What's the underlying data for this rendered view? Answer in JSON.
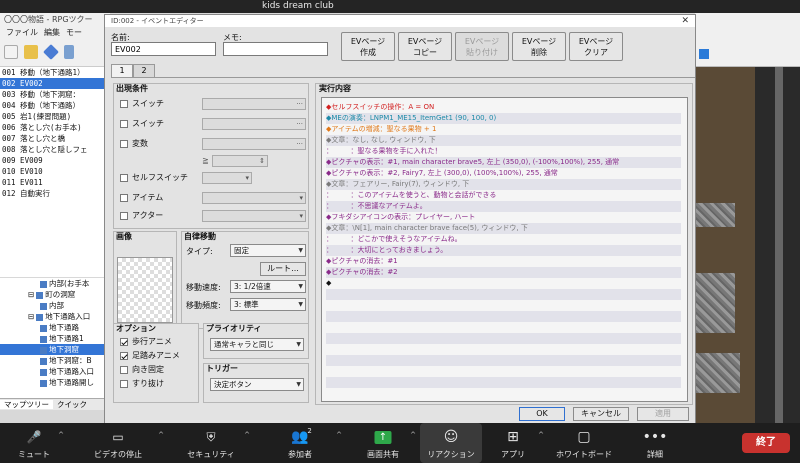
{
  "zoom": {
    "title": "kids dream club",
    "buttons": [
      {
        "icon": "microphone-icon",
        "label": "ミュート"
      },
      {
        "icon": "video-camera-icon",
        "label": "ビデオの停止"
      },
      {
        "icon": "security-shield-icon",
        "label": "セキュリティ"
      },
      {
        "icon": "participants-icon",
        "label": "参加者",
        "count": "2"
      },
      {
        "icon": "share-screen-icon",
        "label": "画面共有"
      },
      {
        "icon": "reaction-icon",
        "label": "リアクション"
      },
      {
        "icon": "apps-icon",
        "label": "アプリ"
      },
      {
        "icon": "whiteboard-icon",
        "label": "ホワイトボード"
      },
      {
        "icon": "more-dots-icon",
        "label": "詳細"
      }
    ],
    "end_label": "終了"
  },
  "app": {
    "title": "〇〇〇物語 - RPGツクー",
    "menu": [
      "ファイル",
      "編集",
      "モー"
    ],
    "map_events": [
      "001 移動（地下通路1）",
      "002 EV002",
      "003 移動（地下洞窟：",
      "004 移動（地下通路）",
      "005 岩1(練習問題)",
      "006 落とし穴(お手本)",
      "007 落とし穴と橋",
      "008 落とし穴と隠しフェ",
      "009 EV009",
      "010 EV010",
      "011 EV011",
      "012 自動実行"
    ],
    "selected_event_index": 1,
    "tree": [
      {
        "label": "内部(お手本",
        "indent": 3
      },
      {
        "label": "町の洞窟",
        "indent": 2,
        "toggle": "⊟"
      },
      {
        "label": "内部",
        "indent": 3
      },
      {
        "label": "地下通路入口",
        "indent": 2,
        "toggle": "⊟"
      },
      {
        "label": "地下通路",
        "indent": 3
      },
      {
        "label": "地下通路1",
        "indent": 3
      },
      {
        "label": "地下洞窟",
        "indent": 3,
        "selected": true
      },
      {
        "label": "地下洞窟：B",
        "indent": 3
      },
      {
        "label": "地下通路入口",
        "indent": 3
      },
      {
        "label": "地下通路開し",
        "indent": 3
      }
    ],
    "bottom_tabs": [
      "マップツリー",
      "クイック"
    ]
  },
  "dialog": {
    "title": "ID:002 - イベントエディター",
    "name_label": "名前:",
    "name_value": "EV002",
    "memo_label": "メモ:",
    "memo_value": "",
    "ev_buttons": [
      {
        "line1": "EVページ",
        "line2": "作成",
        "enabled": true
      },
      {
        "line1": "EVページ",
        "line2": "コピー",
        "enabled": true
      },
      {
        "line1": "EVページ",
        "line2": "貼り付け",
        "enabled": false
      },
      {
        "line1": "EVページ",
        "line2": "削除",
        "enabled": true
      },
      {
        "line1": "EVページ",
        "line2": "クリア",
        "enabled": true
      }
    ],
    "tabs": [
      "1",
      "2"
    ],
    "conditions": {
      "title": "出現条件",
      "switch1": "スイッチ",
      "switch2": "スイッチ",
      "variable": "変数",
      "ge": "≧",
      "self_switch": "セルフスイッチ",
      "item": "アイテム",
      "actor": "アクター"
    },
    "image_title": "画像",
    "autonomous": {
      "title": "自律移動",
      "type_label": "タイプ:",
      "type_value": "固定",
      "route_button": "ルート...",
      "speed_label": "移動速度:",
      "speed_value": "3: 1/2倍速",
      "freq_label": "移動頻度:",
      "freq_value": "3: 標準"
    },
    "options": {
      "title": "オプション",
      "walking": {
        "label": "歩行アニメ",
        "checked": true
      },
      "stepping": {
        "label": "足踏みアニメ",
        "checked": true
      },
      "direction_fix": {
        "label": "向き固定",
        "checked": false
      },
      "through": {
        "label": "すり抜け",
        "checked": false
      }
    },
    "priority": {
      "title": "プライオリティ",
      "value": "通常キャラと同じ"
    },
    "trigger": {
      "title": "トリガー",
      "value": "決定ボタン"
    },
    "contents_title": "実行内容",
    "commands": [
      {
        "text": "◆セルフスイッチの操作：A = ON",
        "color": "#d22020"
      },
      {
        "text": "◆MEの演奏：LNPM1_ME15_ItemGet1 (90, 100, 0)",
        "color": "#1c8aa8"
      },
      {
        "text": "◆アイテムの増減：聖なる果物 + 1",
        "color": "#e07818"
      },
      {
        "text": "◆文章：なし, なし, ウィンドウ, 下",
        "color": "#7a7a7a"
      },
      {
        "text": "：　　　：聖なる果物を手に入れた！",
        "color": "#8a2a8a"
      },
      {
        "text": "◆ピクチャの表示：#1, main character brave5, 左上 (350,0), (-100%,100%), 255, 通常",
        "color": "#8a2a8a"
      },
      {
        "text": "◆ピクチャの表示：#2, Fairy7, 左上 (300,0), (100%,100%), 255, 通常",
        "color": "#8a2a8a"
      },
      {
        "text": "◆文章：フェアリー, Fairy(7), ウィンドウ, 下",
        "color": "#7a7a7a"
      },
      {
        "text": "：　　　：このアイテムを使うと、動物と会話ができる",
        "color": "#8a2a8a"
      },
      {
        "text": "：　　　：不思議なアイテムよ。",
        "color": "#8a2a8a"
      },
      {
        "text": "◆フキダシアイコンの表示：プレイヤー, ハート",
        "color": "#8a2a8a"
      },
      {
        "text": "◆文章：\\N[1], main character brave face(5), ウィンドウ, 下",
        "color": "#7a7a7a"
      },
      {
        "text": "：　　　：どこかで使えそうなアイテムね。",
        "color": "#8a2a8a"
      },
      {
        "text": "：　　　：大切にとっておきましょう。",
        "color": "#8a2a8a"
      },
      {
        "text": "◆ピクチャの消去：#1",
        "color": "#8a2a8a"
      },
      {
        "text": "◆ピクチャの消去：#2",
        "color": "#8a2a8a"
      },
      {
        "text": "◆",
        "color": "#111111"
      }
    ],
    "ok_label": "OK",
    "cancel_label": "キャンセル",
    "apply_label": "適用"
  }
}
